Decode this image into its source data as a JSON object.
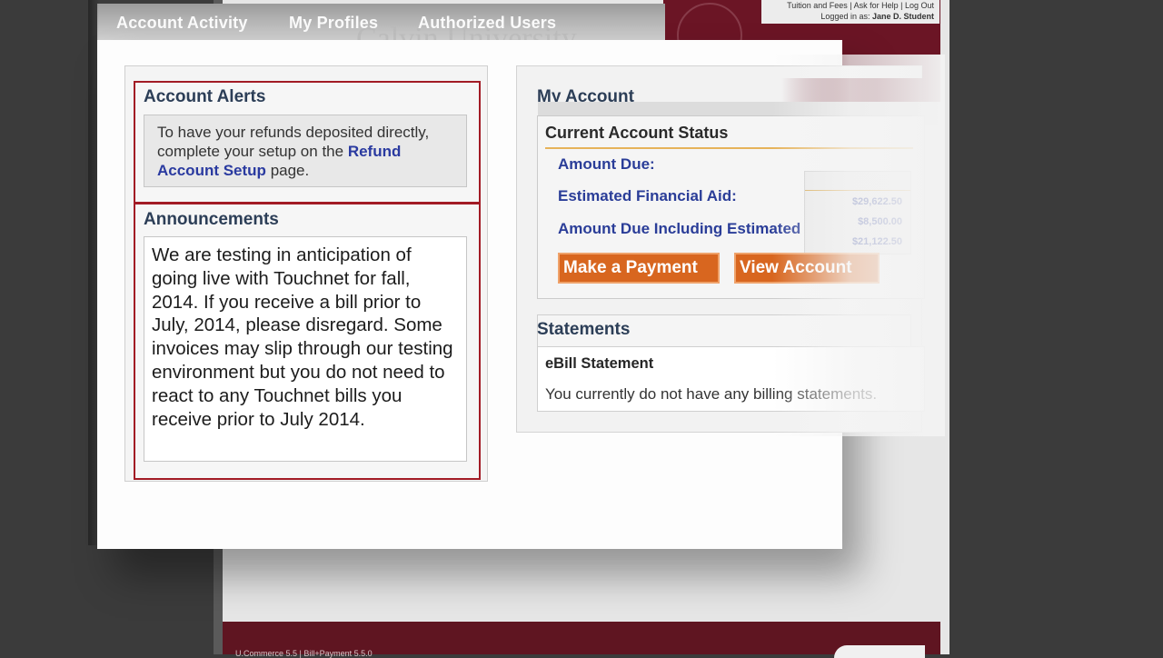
{
  "nav": {
    "items": [
      "Account Activity",
      "My Profiles",
      "Authorized Users"
    ],
    "ghost_title": "Calvin University"
  },
  "top_links": {
    "links": "Tuition and Fees | Ask for Help | Log Out",
    "logged_in_label": "Logged in as:",
    "user": "Jane D. Student"
  },
  "alerts": {
    "title": "Account Alerts",
    "message_before": "To have your refunds deposited directly, complete your setup on the",
    "link": "Refund Account Setup",
    "message_after": "page."
  },
  "announcements": {
    "title": "Announcements",
    "body": "We are testing in anticipation of going live with Touchnet for fall, 2014. If you receive a bill prior to July, 2014, please disregard. Some invoices may slip through our testing environment but you do not need to react to any Touchnet bills you receive prior to July 2014."
  },
  "my_account": {
    "title": "My Account",
    "status_title": "Current Account Status",
    "amount_due_label": "Amount Due:",
    "est_aid_label": "Estimated Financial Aid:",
    "due_incl_label": "Amount Due Including Estimated Aid:",
    "amount_due": "$29,622.50",
    "est_aid": "$8,500.00",
    "due_incl": "$21,122.50",
    "make_payment": "Make a Payment",
    "view_account": "View Account"
  },
  "statements": {
    "title": "Statements",
    "ebill_title": "eBill Statement",
    "ebill_text": "You currently do not have any billing statements."
  },
  "footer": {
    "text": "U.Commerce 5.5 | Bill+Payment 5.5.0"
  },
  "colors": {
    "maroon": "#6b1525",
    "orange_button": "#d8661f",
    "link_blue": "#2a3d98",
    "alert_border": "#a21b25"
  }
}
